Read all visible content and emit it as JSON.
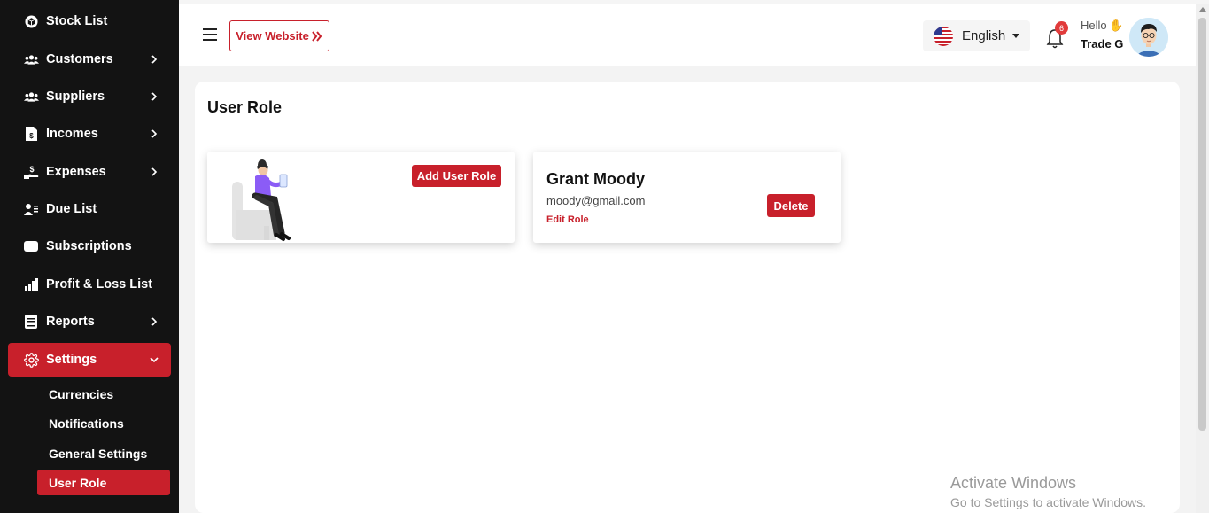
{
  "sidebar": {
    "items": [
      {
        "label": "Stock List",
        "icon": "box-icon",
        "has_chevron": false
      },
      {
        "label": "Customers",
        "icon": "users-icon",
        "has_chevron": true
      },
      {
        "label": "Suppliers",
        "icon": "users-icon",
        "has_chevron": true
      },
      {
        "label": "Incomes",
        "icon": "invoice-icon",
        "has_chevron": true
      },
      {
        "label": "Expenses",
        "icon": "hand-money-icon",
        "has_chevron": true
      },
      {
        "label": "Due List",
        "icon": "user-list-icon",
        "has_chevron": false
      },
      {
        "label": "Subscriptions",
        "icon": "card-icon",
        "has_chevron": false
      },
      {
        "label": "Profit & Loss List",
        "icon": "bar-chart-icon",
        "has_chevron": false
      },
      {
        "label": "Reports",
        "icon": "book-icon",
        "has_chevron": true
      },
      {
        "label": "Settings",
        "icon": "gear-icon",
        "has_chevron": true,
        "active": true
      }
    ],
    "sub_items": [
      {
        "label": "Currencies"
      },
      {
        "label": "Notifications"
      },
      {
        "label": "General Settings"
      },
      {
        "label": "User Role",
        "active": true
      }
    ]
  },
  "header": {
    "view_website": "View Website",
    "language": "English",
    "notification_count": "6",
    "greeting": "Hello",
    "user_name": "Trade G"
  },
  "main": {
    "title": "User Role",
    "add_button": "Add User Role",
    "role_card": {
      "name": "Grant Moody",
      "email": "moody@gmail.com",
      "edit_label": "Edit Role",
      "delete_label": "Delete"
    }
  },
  "watermark": {
    "line1": "Activate Windows",
    "line2": "Go to Settings to activate Windows."
  },
  "colors": {
    "accent": "#c8202b",
    "sidebar_bg": "#131313"
  }
}
